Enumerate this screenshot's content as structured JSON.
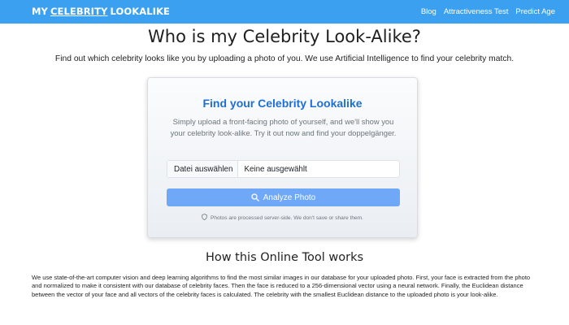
{
  "nav": {
    "brand": {
      "part1": "MY",
      "part2": "CELEBRITY",
      "part3": "LOOKALIKE"
    },
    "links": [
      "Blog",
      "Attractiveness Test",
      "Predict Age"
    ]
  },
  "hero": {
    "title": "Who is my Celebrity Look-Alike?",
    "intro": "Find out which celebrity looks like you by uploading a photo of you. We use Artificial Intelligence to find your celebrity match."
  },
  "card": {
    "title": "Find your Celebrity Lookalike",
    "description": "Simply upload a front-facing photo of yourself, and we'll show you your celebrity look-alike. Try it out now and find your doppelgänger.",
    "file_button": "Datei auswählen",
    "file_status": "Keine ausgewählt",
    "analyze_label": "Analyze Photo",
    "privacy_note": "Photos are processed server-side. We don't save or share them."
  },
  "how": {
    "title": "How this Online Tool works",
    "text": "We use state-of-the-art computer vision and deep learning algorithms to find the most similar images in our database for your uploaded photo. First, your face is extracted from the photo and normalized to make it consistent with our database of celebrity faces. Then the face is reduced to a 256-dimensional vector using a neural network. Finally, the Euclidean distance between the vector of your face and all vectors of the celebrity faces is calculated. The celebrity with the smallest Euclidean distance to the uploaded photo is your look-alike."
  },
  "colors": {
    "navbar": "#3ba0ef",
    "card_title": "#1e6fd4",
    "button": "#6ea8f6"
  },
  "icons": {
    "analyze": "search-icon",
    "privacy": "shield-icon"
  }
}
